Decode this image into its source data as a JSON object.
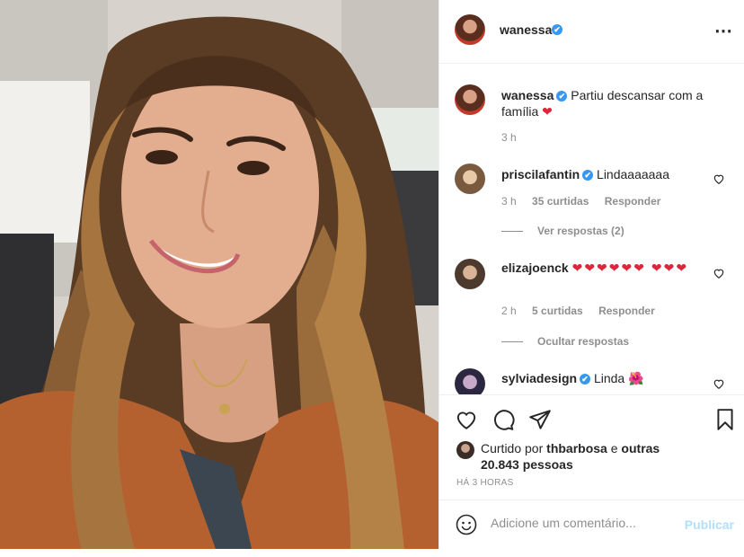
{
  "post": {
    "author": "wanessa",
    "author_verified": "✔",
    "more_icon": "⋯",
    "caption_text": "Partiu descansar com a família",
    "caption_emoji": "❤",
    "caption_time": "3 h"
  },
  "comments": [
    {
      "user": "priscilafantin",
      "text": "Lindaaaaaaa",
      "time": "3 h",
      "likes": "35 curtidas",
      "reply": "Responder",
      "toggle": "Ver respostas (2)"
    },
    {
      "user": "elizajoenck",
      "text": "❤❤❤❤❤❤ ❤❤❤",
      "time": "2 h",
      "likes": "5 curtidas",
      "reply": "Responder",
      "toggle": "Ocultar respostas"
    },
    {
      "user": "sylviadesign",
      "text": "Linda 🌺"
    }
  ],
  "likes": {
    "prefix": "Curtido por",
    "user": "thbarbosa",
    "joiner": "e",
    "others": "outras 20.843 pessoas"
  },
  "time_ago": "HÁ 3 HORAS",
  "comment_box": {
    "placeholder": "Adicione um comentário...",
    "publish": "Publicar"
  },
  "colors": {
    "accent": "#3897f0",
    "publish_disabled": "#b2dffc",
    "heart": "#e0243a"
  }
}
